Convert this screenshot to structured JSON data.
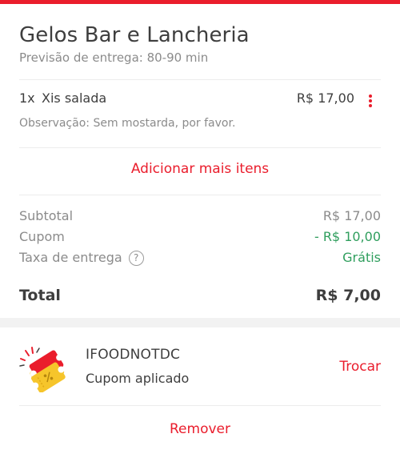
{
  "colors": {
    "accent": "#ea1d2c",
    "success": "#2f9e5d",
    "muted": "#8b8b8b",
    "text": "#3e3e3e"
  },
  "store": {
    "name": "Gelos Bar e Lancheria",
    "eta": "Previsão de entrega: 80-90 min"
  },
  "item": {
    "quantity": "1x",
    "name": "Xis salada",
    "price": "R$ 17,00",
    "note": "Observação: Sem mostarda, por favor.",
    "menu_icon": "kebab-menu-icon"
  },
  "add_more_label": "Adicionar mais itens",
  "summary": {
    "subtotal_label": "Subtotal",
    "subtotal_value": "R$ 17,00",
    "coupon_label": "Cupom",
    "coupon_value": "- R$ 10,00",
    "delivery_label": "Taxa de entrega",
    "delivery_help": "?",
    "delivery_value": "Grátis",
    "total_label": "Total",
    "total_value": "R$ 7,00"
  },
  "coupon": {
    "icon": "coupon-ticket-icon",
    "code": "IFOODNOTDC",
    "status": "Cupom aplicado",
    "swap_label": "Trocar",
    "remove_label": "Remover"
  }
}
